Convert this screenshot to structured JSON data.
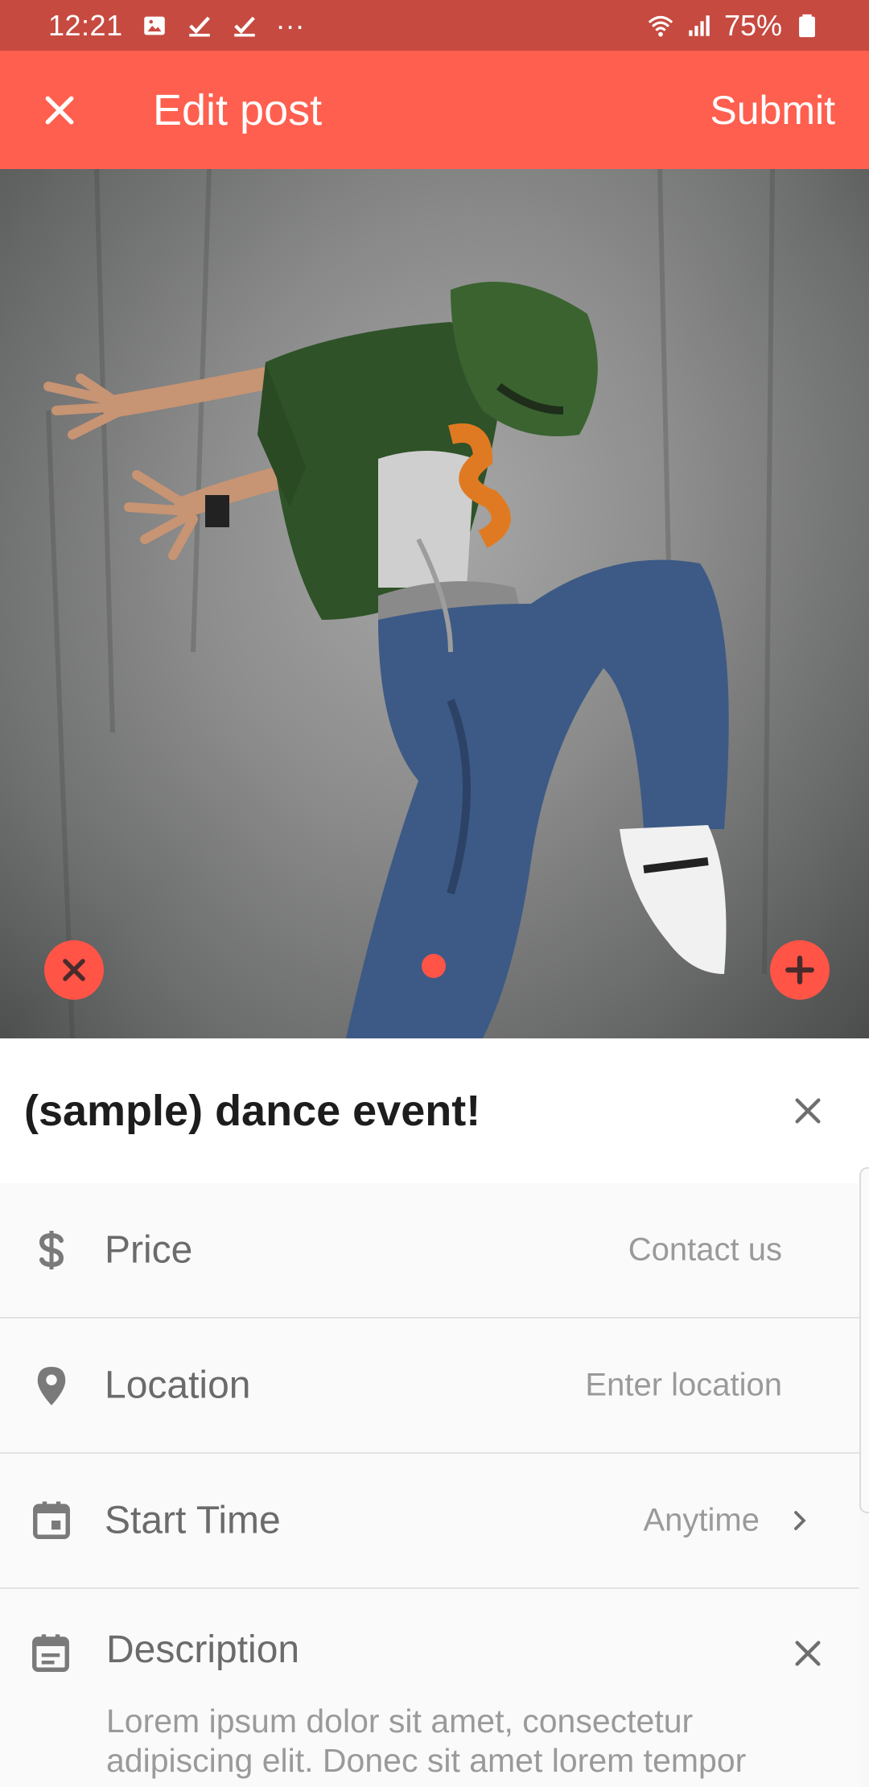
{
  "status_bar": {
    "time": "12:21",
    "more": "···",
    "battery": "75%"
  },
  "header": {
    "title": "Edit post",
    "submit_label": "Submit",
    "accent_color": "#ff5f4f"
  },
  "photo": {
    "description_icon": "dancer-photo",
    "remove_icon": "close-circle-icon",
    "add_icon": "plus-circle-icon"
  },
  "form": {
    "title_value": "(sample) dance event!",
    "price": {
      "label": "Price",
      "value": "Contact us"
    },
    "location": {
      "label": "Location",
      "value": "Enter location"
    },
    "start_time": {
      "label": "Start Time",
      "value": "Anytime"
    },
    "description": {
      "label": "Description",
      "value": "Lorem ipsum dolor sit amet, consectetur adipiscing elit. Donec sit amet lorem tempor"
    }
  }
}
